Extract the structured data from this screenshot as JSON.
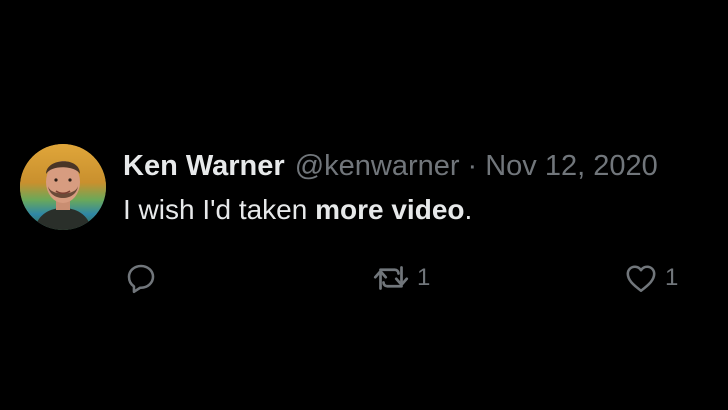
{
  "tweet": {
    "author": {
      "display_name": "Ken Warner",
      "handle": "@kenwarner"
    },
    "separator": "·",
    "date": "Nov 12, 2020",
    "text_plain": "I wish I'd taken ",
    "text_bold": "more video",
    "text_end": ".",
    "actions": {
      "reply_icon": "reply-icon",
      "retweet_icon": "retweet-icon",
      "retweet_count": "1",
      "like_icon": "heart-icon",
      "like_count": "1"
    }
  },
  "colors": {
    "background": "#000000",
    "primary_text": "#e7e9ea",
    "secondary_text": "#71767b"
  }
}
